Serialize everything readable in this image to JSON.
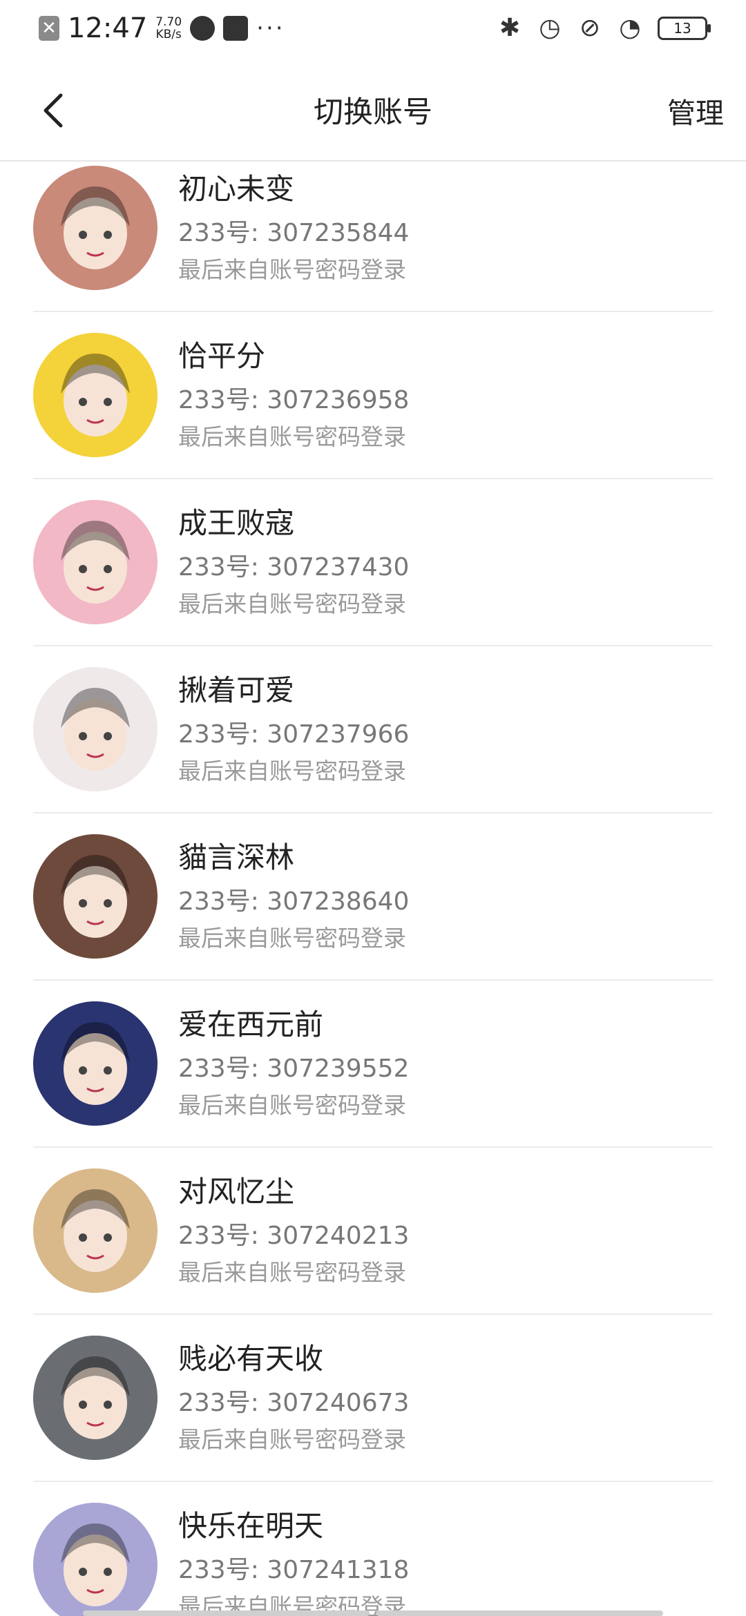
{
  "status_bar": {
    "time": "12:47",
    "net_speed_value": "7.70",
    "net_speed_unit": "KB/s",
    "more": "···",
    "battery": "13",
    "icons": [
      "close-notification-icon",
      "speedometer-icon",
      "mail-icon",
      "bluetooth-icon",
      "alarm-icon",
      "mute-icon",
      "wifi-icon",
      "battery-icon"
    ]
  },
  "header": {
    "title": "切换账号",
    "manage": "管理",
    "back_icon": "chevron-left-icon"
  },
  "accounts": [
    {
      "name": "初心未变",
      "number": "233号: 307235844",
      "login": "最后来自账号密码登录",
      "avatar_color": "#c98a7a"
    },
    {
      "name": "恰平分",
      "number": "233号: 307236958",
      "login": "最后来自账号密码登录",
      "avatar_color": "#f4d23a"
    },
    {
      "name": "成王败寇",
      "number": "233号: 307237430",
      "login": "最后来自账号密码登录",
      "avatar_color": "#f2b8c6"
    },
    {
      "name": "揪着可爱",
      "number": "233号: 307237966",
      "login": "最后来自账号密码登录",
      "avatar_color": "#efe9ea"
    },
    {
      "name": "貓言深林",
      "number": "233号: 307238640",
      "login": "最后来自账号密码登录",
      "avatar_color": "#6e4a3c"
    },
    {
      "name": "爱在西元前",
      "number": "233号: 307239552",
      "login": "最后来自账号密码登录",
      "avatar_color": "#2a3470"
    },
    {
      "name": "对风忆尘",
      "number": "233号: 307240213",
      "login": "最后来自账号密码登录",
      "avatar_color": "#d9b98a"
    },
    {
      "name": "贱必有天收",
      "number": "233号: 307240673",
      "login": "最后来自账号密码登录",
      "avatar_color": "#6a6e72"
    },
    {
      "name": "快乐在明天",
      "number": "233号: 307241318",
      "login": "最后来自账号密码登录",
      "avatar_color": "#a9a6d6"
    }
  ]
}
